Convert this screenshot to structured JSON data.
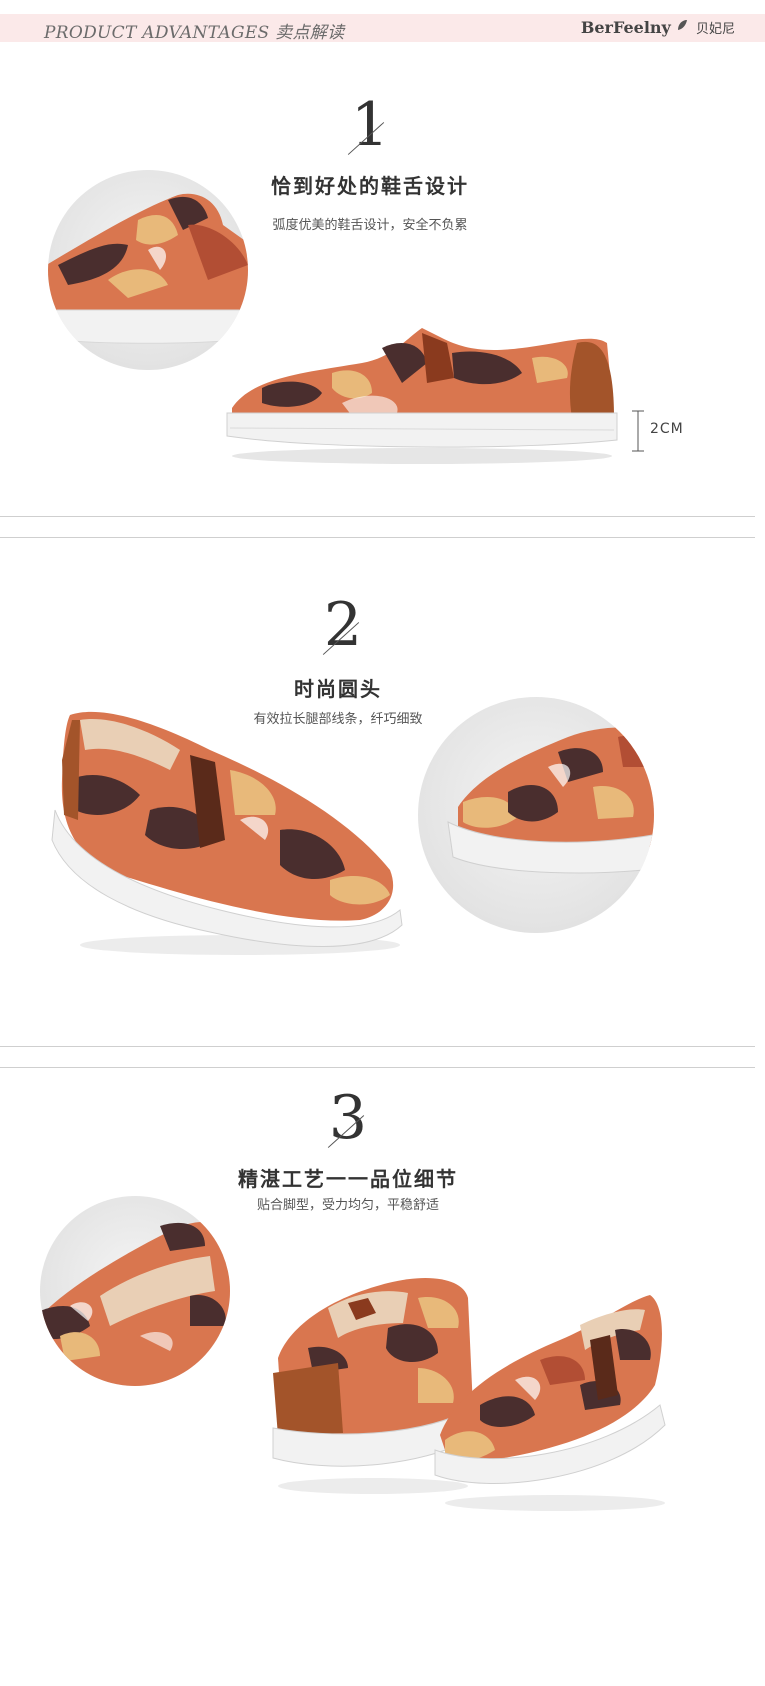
{
  "header": {
    "title": "PRODUCT ADVANTAGES 卖点解读",
    "brand": "BerFeelny",
    "brand_cn": "贝妃尼"
  },
  "sections": [
    {
      "number": "1",
      "heading": "恰到好处的鞋舌设计",
      "subtitle": "弧度优美的鞋舌设计，安全不负累",
      "dimension_label": "2CM"
    },
    {
      "number": "2",
      "heading": "时尚圆头",
      "subtitle": "有效拉长腿部线条，纤巧细致"
    },
    {
      "number": "3",
      "heading": "精湛工艺一一品位细节",
      "subtitle": "贴合脚型，受力均匀，平稳舒适"
    }
  ],
  "colors": {
    "header_bg": "#fbe9e9",
    "camo_orange": "#d9764f",
    "camo_brown": "#4a2e2e",
    "camo_tan": "#e8b97a",
    "leather_brown": "#a3542a",
    "sole_white": "#f2f2f2"
  }
}
